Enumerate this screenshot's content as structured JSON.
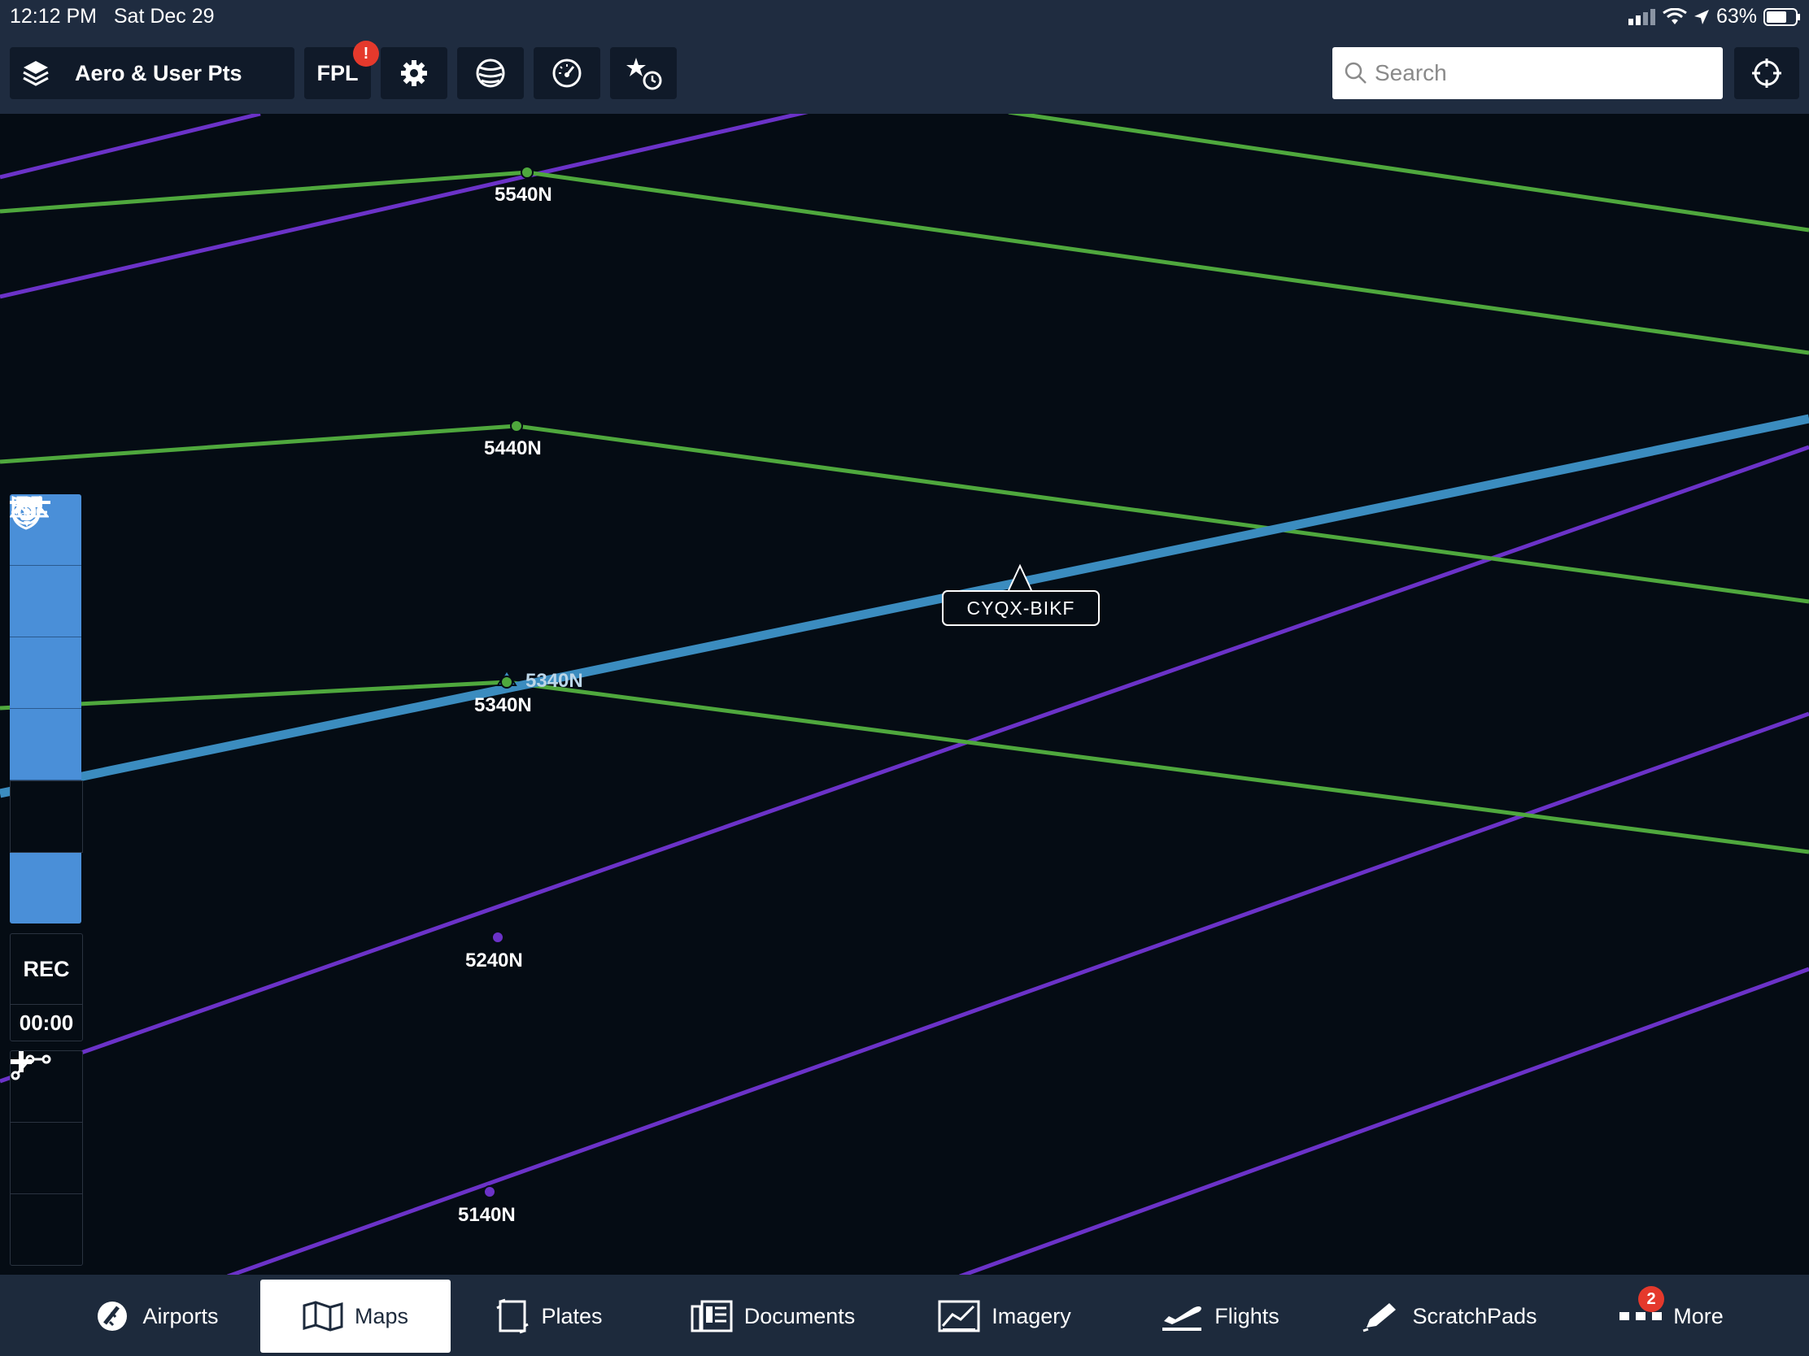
{
  "status_bar": {
    "time": "12:12 PM",
    "date": "Sat Dec 29",
    "battery": "63%"
  },
  "toolbar": {
    "layers_label": "Aero & User Pts",
    "fpl_label": "FPL",
    "fpl_badge": "!",
    "search_placeholder": "Search"
  },
  "map": {
    "waypoints": [
      "5540N",
      "5440N",
      "5340N",
      "5340N",
      "5240N",
      "5140N"
    ],
    "route_label": "CYQX-BIKF",
    "colors": {
      "track_green": "#4fa83d",
      "track_purple": "#6b32c8",
      "route_blue": "#3b8cbf"
    }
  },
  "side_tools": {
    "rec_label": "REC",
    "rec_time": "00:00"
  },
  "tabs": [
    {
      "label": "Airports"
    },
    {
      "label": "Maps"
    },
    {
      "label": "Plates"
    },
    {
      "label": "Documents"
    },
    {
      "label": "Imagery"
    },
    {
      "label": "Flights"
    },
    {
      "label": "ScratchPads"
    },
    {
      "label": "More"
    }
  ],
  "more_badge": "2"
}
